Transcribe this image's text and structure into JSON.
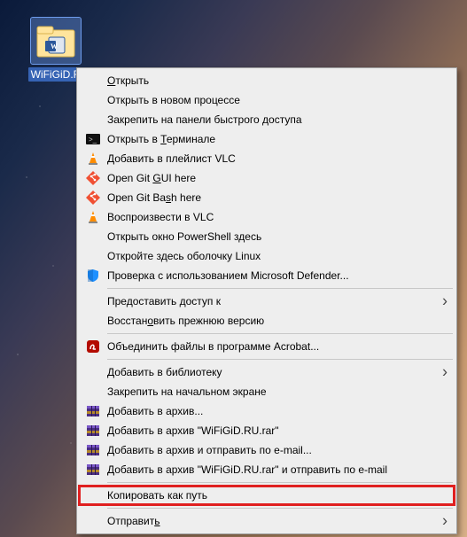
{
  "desktop": {
    "file_label": "WiFiGiD.R"
  },
  "menu": {
    "items": [
      {
        "kind": "item",
        "label": "Открыть",
        "u": 0,
        "icon": "",
        "sub": false,
        "int": true,
        "name": "menu-open"
      },
      {
        "kind": "item",
        "label": "Открыть в новом процессе",
        "u": -1,
        "icon": "",
        "sub": false,
        "int": true,
        "name": "menu-open-new-process"
      },
      {
        "kind": "item",
        "label": "Закрепить на панели быстрого доступа",
        "u": -1,
        "icon": "",
        "sub": false,
        "int": true,
        "name": "menu-pin-quick"
      },
      {
        "kind": "item",
        "label": "Открыть в Терминале",
        "u": 10,
        "icon": "terminal",
        "sub": false,
        "int": true,
        "name": "menu-open-terminal"
      },
      {
        "kind": "item",
        "label": "Добавить в плейлист VLC",
        "u": -1,
        "icon": "vlc",
        "sub": false,
        "int": true,
        "name": "menu-vlc-playlist"
      },
      {
        "kind": "item",
        "label": "Open Git GUI here",
        "u": 9,
        "icon": "git",
        "sub": false,
        "int": true,
        "name": "menu-git-gui"
      },
      {
        "kind": "item",
        "label": "Open Git Bash here",
        "u": 11,
        "icon": "git",
        "sub": false,
        "int": true,
        "name": "menu-git-bash"
      },
      {
        "kind": "item",
        "label": "Воспроизвести в VLC",
        "u": -1,
        "icon": "vlc",
        "sub": false,
        "int": true,
        "name": "menu-vlc-play"
      },
      {
        "kind": "item",
        "label": "Открыть окно PowerShell здесь",
        "u": -1,
        "icon": "",
        "sub": false,
        "int": true,
        "name": "menu-powershell"
      },
      {
        "kind": "item",
        "label": "Откройте здесь оболочку Linux",
        "u": -1,
        "icon": "",
        "sub": false,
        "int": true,
        "name": "menu-linux-shell"
      },
      {
        "kind": "item",
        "label": "Проверка с использованием Microsoft Defender...",
        "u": -1,
        "icon": "defender",
        "sub": false,
        "int": true,
        "name": "menu-defender"
      },
      {
        "kind": "sep"
      },
      {
        "kind": "item",
        "label": "Предоставить доступ к",
        "u": -1,
        "icon": "",
        "sub": true,
        "int": true,
        "name": "menu-share"
      },
      {
        "kind": "item",
        "label": "Восстановить прежнюю версию",
        "u": 7,
        "icon": "",
        "sub": false,
        "int": true,
        "name": "menu-restore"
      },
      {
        "kind": "sep"
      },
      {
        "kind": "item",
        "label": "Объединить файлы в программе Acrobat...",
        "u": -1,
        "icon": "acrobat",
        "sub": false,
        "int": true,
        "name": "menu-acrobat"
      },
      {
        "kind": "sep"
      },
      {
        "kind": "item",
        "label": "Добавить в библиотеку",
        "u": -1,
        "icon": "",
        "sub": true,
        "int": true,
        "name": "menu-library"
      },
      {
        "kind": "item",
        "label": "Закрепить на начальном экране",
        "u": -1,
        "icon": "",
        "sub": false,
        "int": true,
        "name": "menu-pin-start"
      },
      {
        "kind": "item",
        "label": "Добавить в архив...",
        "u": -1,
        "icon": "rar",
        "sub": false,
        "int": true,
        "name": "menu-rar-add"
      },
      {
        "kind": "item",
        "label": "Добавить в архив \"WiFiGiD.RU.rar\"",
        "u": -1,
        "icon": "rar",
        "sub": false,
        "int": true,
        "name": "menu-rar-add-named"
      },
      {
        "kind": "item",
        "label": "Добавить в архив и отправить по e-mail...",
        "u": -1,
        "icon": "rar",
        "sub": false,
        "int": true,
        "name": "menu-rar-email"
      },
      {
        "kind": "item",
        "label": "Добавить в архив \"WiFiGiD.RU.rar\" и отправить по e-mail",
        "u": -1,
        "icon": "rar",
        "sub": false,
        "int": true,
        "name": "menu-rar-email-named"
      },
      {
        "kind": "sep"
      },
      {
        "kind": "item",
        "label": "Копировать как путь",
        "u": -1,
        "icon": "",
        "sub": false,
        "int": true,
        "name": "menu-copy-path",
        "highlight": true
      },
      {
        "kind": "sep"
      },
      {
        "kind": "item",
        "label": "Отправить",
        "u": 8,
        "icon": "",
        "sub": true,
        "int": true,
        "name": "menu-send-to"
      }
    ]
  },
  "icons": {
    "terminal": "terminal-icon",
    "vlc": "vlc-icon",
    "git": "git-icon",
    "defender": "defender-icon",
    "acrobat": "acrobat-icon",
    "rar": "rar-icon"
  }
}
